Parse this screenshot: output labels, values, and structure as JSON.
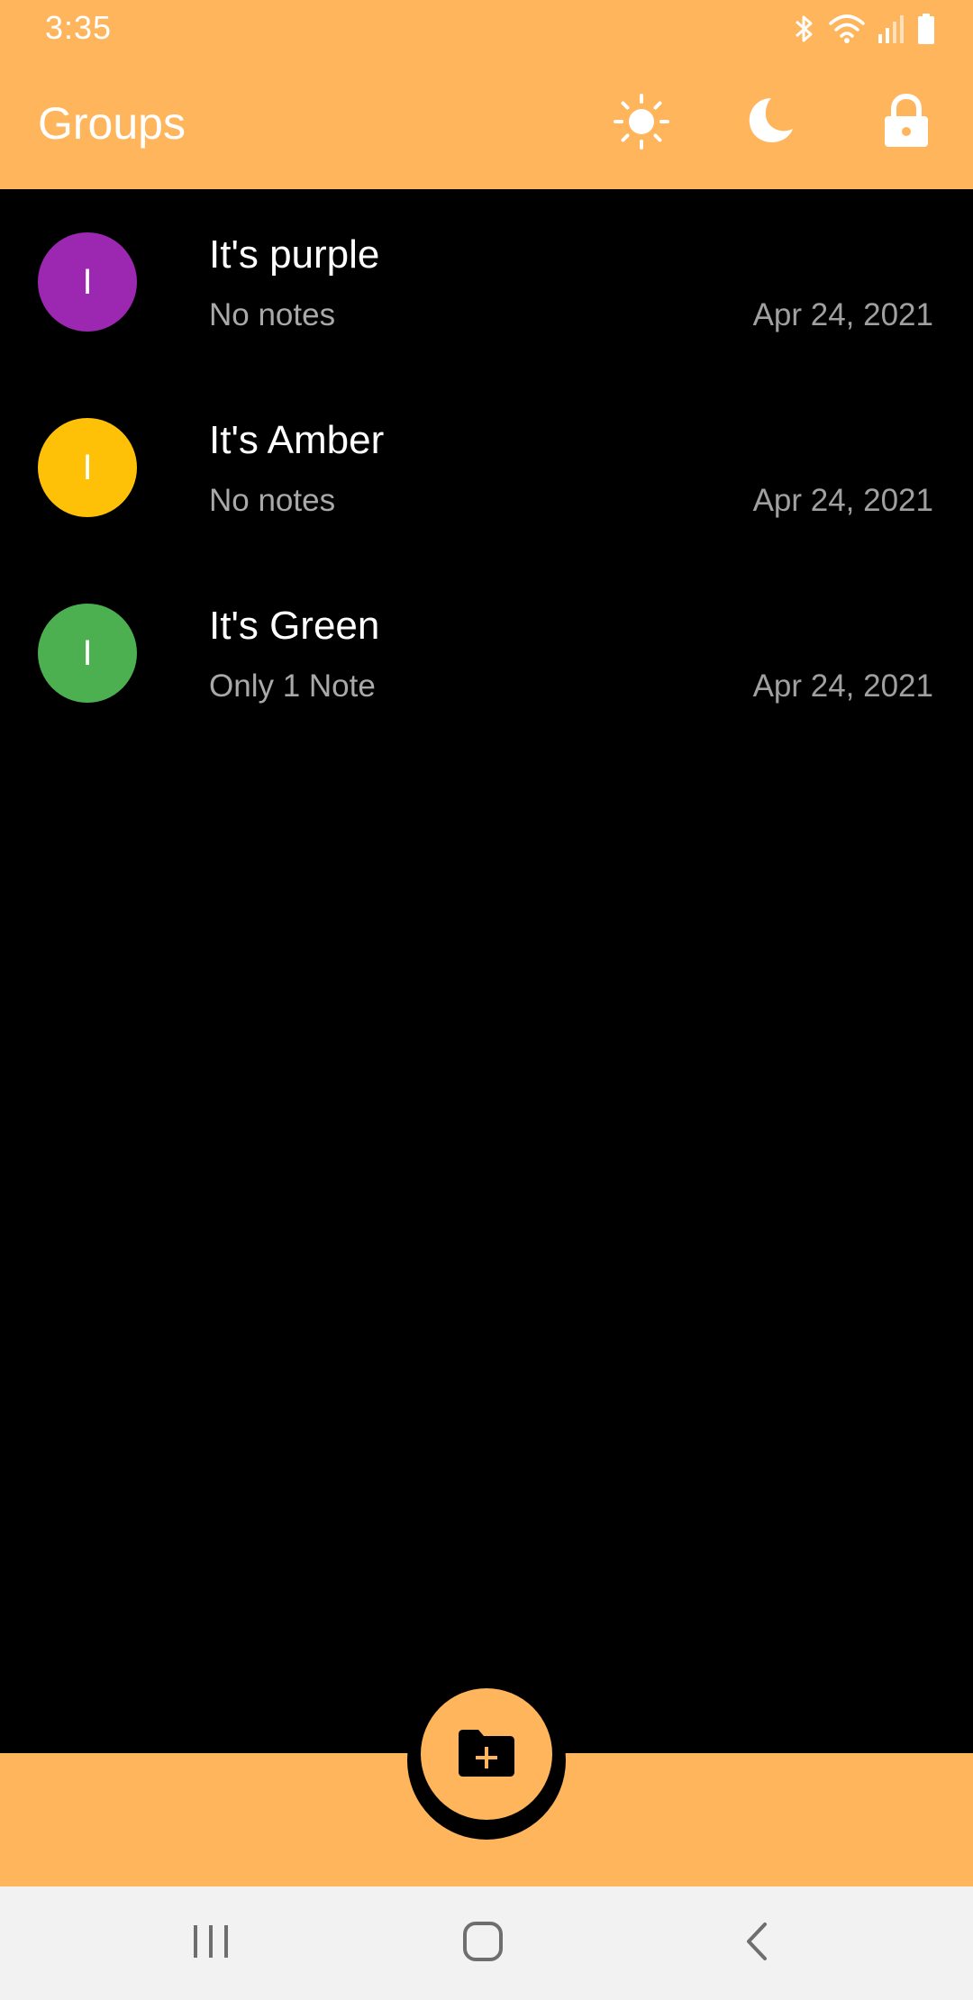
{
  "status_bar": {
    "time": "3:35",
    "icons": [
      "bluetooth-icon",
      "wifi-icon",
      "signal-icon",
      "battery-icon"
    ]
  },
  "app_bar": {
    "title": "Groups",
    "actions": [
      {
        "name": "light-theme-button",
        "icon": "sun-icon"
      },
      {
        "name": "dark-theme-button",
        "icon": "moon-icon"
      },
      {
        "name": "lock-button",
        "icon": "lock-icon"
      }
    ]
  },
  "groups": [
    {
      "initial": "I",
      "title": "It's purple",
      "subtitle": "No notes",
      "date": "Apr 24, 2021",
      "color": "#9C27B0"
    },
    {
      "initial": "I",
      "title": "It's Amber",
      "subtitle": "No notes",
      "date": "Apr 24, 2021",
      "color": "#FFC107"
    },
    {
      "initial": "I",
      "title": "It's Green",
      "subtitle": "Only 1 Note",
      "date": "Apr 24, 2021",
      "color": "#4CAF50"
    }
  ],
  "fab": {
    "icon": "create-new-folder-icon"
  },
  "nav_bar": {
    "buttons": [
      {
        "name": "recent-apps-button",
        "icon": "recents-icon"
      },
      {
        "name": "home-button",
        "icon": "home-icon"
      },
      {
        "name": "back-button",
        "icon": "back-icon"
      }
    ]
  },
  "colors": {
    "accent": "#FFB55C",
    "background": "#000000",
    "nav_background": "#F2F2F2"
  }
}
